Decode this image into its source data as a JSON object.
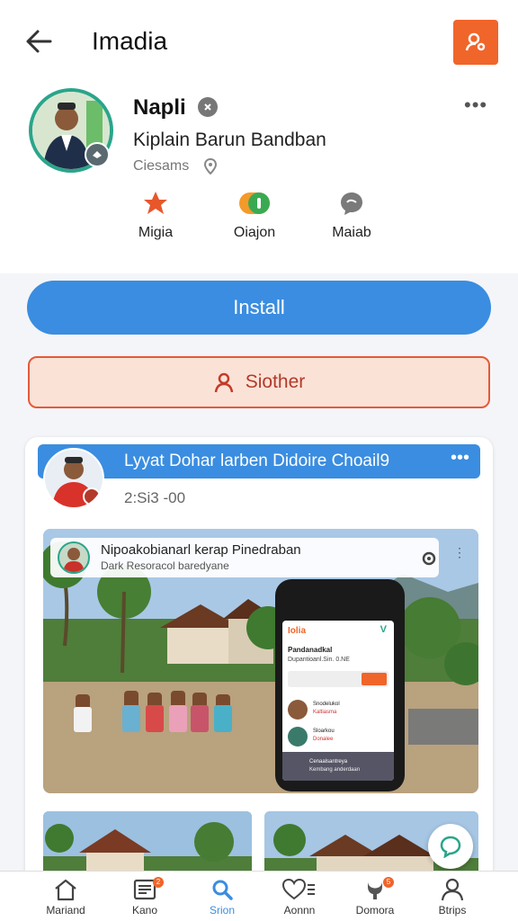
{
  "header": {
    "title": "Imadia",
    "back_icon": "arrow-left-icon",
    "action_icon": "user-key-icon",
    "accent": "#f0652a"
  },
  "profile": {
    "name": "Napli",
    "subtitle": "Kiplain Barun Bandban",
    "meta": "Ciesams",
    "stats": [
      {
        "label": "Migia",
        "icon": "star-icon",
        "color": "#e8572a"
      },
      {
        "label": "Oiajon",
        "icon": "toggle-icon",
        "color": "#3aaa52"
      },
      {
        "label": "Maiab",
        "icon": "chat-icon",
        "color": "#7a7a7a"
      }
    ]
  },
  "actions": {
    "install_label": "Install",
    "other_label": "Siother"
  },
  "post": {
    "title": "Lyyat Dohar larben Didoire Choail9",
    "time": "2:Si3 -00",
    "overlay_title": "Nipoakobianarl kerap Pinedraban",
    "overlay_sub": "Dark Resoracol baredyane",
    "phone": {
      "brand": "Iolia",
      "title": "Pandanadkal",
      "subtitle": "Dupantioanl.Sin. 0.NE",
      "rows": [
        {
          "t1": "Snodelukol",
          "t2": "Kaltiasma"
        },
        {
          "t1": "Sloarkou",
          "t2": "Donalee"
        }
      ],
      "bottom_t1": "Cenaalsantreya",
      "bottom_t2": "Kembang anderdaan"
    }
  },
  "nav": [
    {
      "label": "Mariand",
      "icon": "home-icon",
      "active": false,
      "badge": ""
    },
    {
      "label": "Kano",
      "icon": "news-icon",
      "active": false,
      "badge": "2"
    },
    {
      "label": "Srion",
      "icon": "search-icon",
      "active": true,
      "badge": ""
    },
    {
      "label": "Aonnn",
      "icon": "heart-icon",
      "active": false,
      "badge": ""
    },
    {
      "label": "Domora",
      "icon": "gift-icon",
      "active": false,
      "badge": "5"
    },
    {
      "label": "Btrips",
      "icon": "user-icon",
      "active": false,
      "badge": ""
    }
  ]
}
